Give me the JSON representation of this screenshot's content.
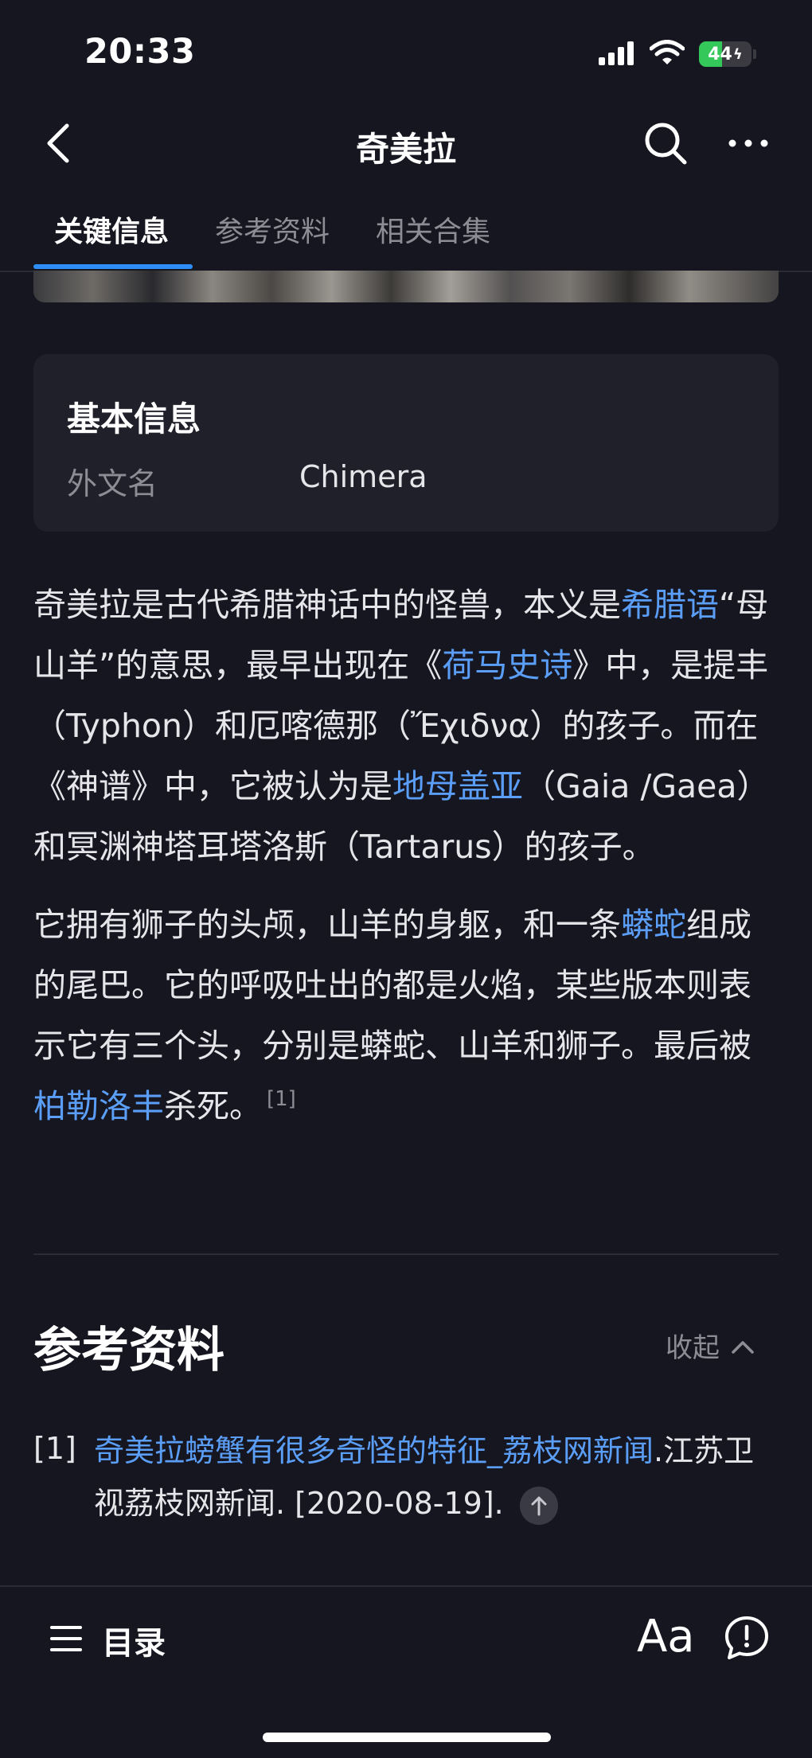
{
  "status": {
    "time": "20:33",
    "battery_text": "44",
    "battery_level": 0.44,
    "battery_color": "#34c759"
  },
  "nav": {
    "title": "奇美拉",
    "back_icon": "chevron-left-icon",
    "search_icon": "search-icon",
    "more_icon": "more-horizontal-icon"
  },
  "tabs": [
    {
      "label": "关键信息",
      "active": true
    },
    {
      "label": "参考资料",
      "active": false
    },
    {
      "label": "相关合集",
      "active": false
    }
  ],
  "info_card": {
    "title": "基本信息",
    "rows": [
      {
        "key": "外文名",
        "value": "Chimera"
      }
    ]
  },
  "article": {
    "p1": {
      "t1": "奇美拉是古代希腊神话中的怪兽，本义是",
      "link1": "希腊语",
      "t2": "“母山羊”的意思，最早出现在《",
      "link2": "荷马史诗",
      "t3": "》中，是提丰（Typhon）和厄喀德那（Ἔχιδνα）的孩子。而在《神谱》中，它被认为是",
      "link3": "地母盖亚",
      "t4": "（Gaia /Gaea）和冥渊神塔耳塔洛斯（Tartarus）的孩子。"
    },
    "p2": {
      "t1": "它拥有狮子的头颅，山羊的身躯，和一条",
      "link1": "蟒蛇",
      "t2": "组成的尾巴。它的呼吸吐出的都是火焰，某些版本则表示它有三个头，分别是蟒蛇、山羊和狮子。最后被",
      "link2": "柏勒洛丰",
      "t3": "杀死。",
      "citation": "[1]"
    }
  },
  "references": {
    "title": "参考资料",
    "collapse_label": "收起",
    "items": [
      {
        "num": "[1]",
        "link": "奇美拉螃蟹有很多奇怪的特征_荔枝网新闻",
        "source": ".江苏卫视荔枝网新闻. [2020-08-19]."
      }
    ]
  },
  "bottom": {
    "toc_label": "目录",
    "font_label": "Aa",
    "feedback_icon": "feedback-icon"
  },
  "colors": {
    "background": "#161620",
    "link": "#5b9ef7",
    "accent": "#2f8ef6"
  }
}
